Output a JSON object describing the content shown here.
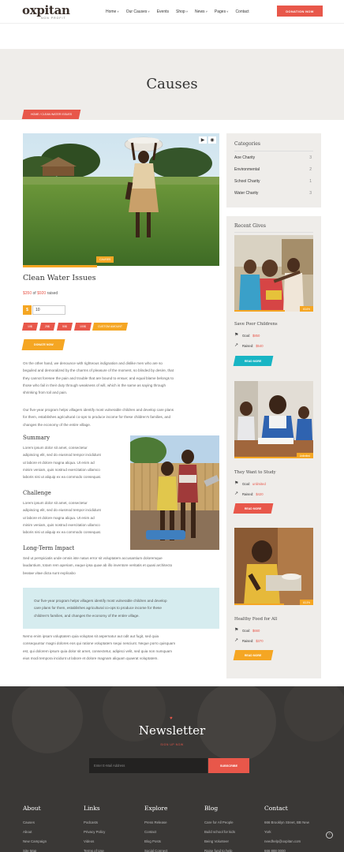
{
  "header": {
    "logo": "oxpitan",
    "logo_sub": "non profit",
    "nav": [
      "Home",
      "Our Causes",
      "Events",
      "Shop",
      "News",
      "Pages",
      "Contact"
    ],
    "nav_dropdown": [
      true,
      true,
      false,
      true,
      true,
      true,
      false
    ],
    "donate_label": "DONATION NOW"
  },
  "page": {
    "title": "Causes",
    "breadcrumb": "HOME  /  CLEAN WATER ISSUES"
  },
  "cause": {
    "badge": "CAUSES",
    "title": "Clean Water Issues",
    "raised_amount": "$350",
    "raised_of": "of",
    "goal_amount": "$920",
    "raised_suffix": "raised",
    "currency": "$",
    "amount_value": "10",
    "amounts": [
      "10$",
      "25$",
      "50$",
      "100$"
    ],
    "custom_amount": "CUSTOM AMOUNT",
    "donate_label": "DONATE NOW",
    "intro_lines": [
      "On the other hand, we denounce with righteous indignation and dislike men who are so",
      "beguiled and demoralized by the charms of pleasure of the moment, so blinded by desire, that",
      "they cannot foresee the pain and trouble that are bound to ensue; and equal blame belongs to",
      "those who fail in their duty through weakness of will, which is the same as saying through",
      "shrinking from toil and pain."
    ],
    "plan_lines": [
      "Our five-year program helps villagers identify most vulnerable children and develop care plans",
      "for them, establishes agricultural co-ops to produce income for these children's families, and",
      "changes the economy of the entire village."
    ],
    "summary_title": "Summary",
    "summary_lines": [
      "Lorem ipsum dolor sit amet, consectetur",
      "adipiscing elit, sed do eiusmod tempor incididunt",
      "ut labore et dolore magna aliqua. Ut enim ad",
      "minim veniam, quis nostrud exercitation ullamco",
      "laboris nisi ut aliquip ex ea commodo consequat."
    ],
    "challenge_title": "Challenge",
    "challenge_lines": [
      "Lorem ipsum dolor sit amet, consectetur",
      "adipiscing elit, sed do eiusmod tempor incididunt",
      "ut labore et dolore magna aliqua. Ut enim ad",
      "minim veniam, quis nostrud exercitation ullamco",
      "laboris nisi ut aliquip ex ea commodo consequat."
    ],
    "longterm_title": "Long-Term Impact",
    "longterm_lines": [
      "Sed ut perspiciatis unde omnis iste natus error sit voluptatem accusantium doloremque",
      "laudantium, totam rem aperiam, eaque ipsa quae ab illo inventore veritatis et quasi architecto",
      "beatae vitae dicta sunt explicabo"
    ],
    "quote_lines": [
      "Our five-year program helps villagers identify most vulnerable children and develop",
      "care plans for them, establishes agricultural co-ops to produce income for these",
      "children's families, and changes the economy of the entire village."
    ],
    "closing_lines": [
      "Nemo enim ipsam voluptatem quia voluptas sit aspernatur aut odit aut fugit, sed quia",
      "consequuntur magni dolores eos qui ratione voluptatem sequi nesciunt. Neque porro quisquam",
      "est, qui dolorem ipsum quia dolor sit amet, consectetur, adipisci velit, sed quia non numquam",
      "eius modi tempora incidunt ut labore et dolore magnam aliquam quaerat voluptatem."
    ]
  },
  "sidebar": {
    "categories_title": "Categories",
    "categories": [
      {
        "name": "Aoe Charity",
        "count": "3"
      },
      {
        "name": "Environmental",
        "count": "2"
      },
      {
        "name": "School Charity",
        "count": "1"
      },
      {
        "name": "Water Charity",
        "count": "3"
      }
    ],
    "gives_title": "Recent Gives",
    "gifts": [
      {
        "badge": "63.6%",
        "progress": 0.636,
        "title": "Save Poor Childrens",
        "goal_label": "Goal:",
        "goal": "$850",
        "raised_label": "Raised:",
        "raised": "$540",
        "button": "READ MORE",
        "button_color": "#19b5c4"
      },
      {
        "badge": "Unlimited",
        "progress": 1.0,
        "title": "They Want to Study",
        "goal_label": "Goal:",
        "goal": "unlimited",
        "raised_label": "Raised:",
        "raised": "$420",
        "button": "READ MORE",
        "button_color": "#e8574a"
      },
      {
        "badge": "63.3%",
        "progress": 0.633,
        "title": "Healthy Food for All",
        "goal_label": "Goal:",
        "goal": "$660",
        "raised_label": "Raised:",
        "raised": "$370",
        "button": "READ MORE",
        "button_color": "#f5a623"
      }
    ]
  },
  "newsletter": {
    "title": "Newsletter",
    "subtitle": "SIGN UP NOW",
    "placeholder": "Enter E-Mail Address",
    "button": "SUBSCRIBE"
  },
  "footer": {
    "columns": [
      {
        "title": "About",
        "items": [
          "Causes",
          "About",
          "New Campaign",
          "Site Map"
        ]
      },
      {
        "title": "Links",
        "items": [
          "Podcasts",
          "Privacy Policy",
          "Videos",
          "Terms of Use"
        ]
      },
      {
        "title": "Explore",
        "items": [
          "Press Release",
          "Contact",
          "Blog Posts",
          "Social Connect"
        ]
      },
      {
        "title": "Blog",
        "items": [
          "Care for All People",
          "Build school for kids",
          "Being Volunteer",
          "Raise fund to help"
        ]
      },
      {
        "title": "Contact",
        "items": [
          "666 Brooklyn Street, BB New",
          "York",
          "needhelp@oxpitan.com",
          "666 888 0000"
        ]
      }
    ]
  }
}
